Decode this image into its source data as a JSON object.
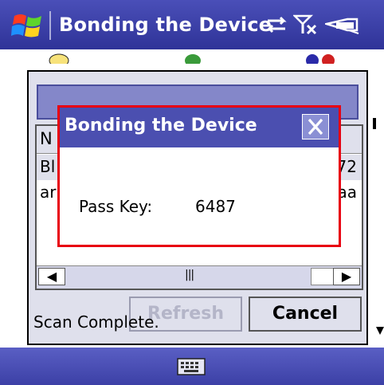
{
  "taskbar": {
    "title": "Bonding the Device",
    "icons": [
      "start-flag-icon",
      "connectivity-icon",
      "signal-off-icon",
      "battery-icon"
    ]
  },
  "background": {
    "list_header": "N",
    "rows": [
      {
        "left": "Bl",
        "right": "72"
      },
      {
        "left": "ar",
        "right": "aa"
      }
    ],
    "refresh_label": "Refresh",
    "cancel_label": "Cancel",
    "status": "Scan Complete."
  },
  "dialog": {
    "title": "Bonding the Device",
    "pass_key_label": "Pass Key:",
    "pass_key_value": "6487",
    "close_icon": "close-icon"
  },
  "softkeys": {
    "icon": "keyboard-icon"
  },
  "colors": {
    "titlebar": "#3a3ea6",
    "dialog_title": "#4b4fb0",
    "dialog_border": "#e8000f",
    "panel": "#dfe0ec"
  }
}
